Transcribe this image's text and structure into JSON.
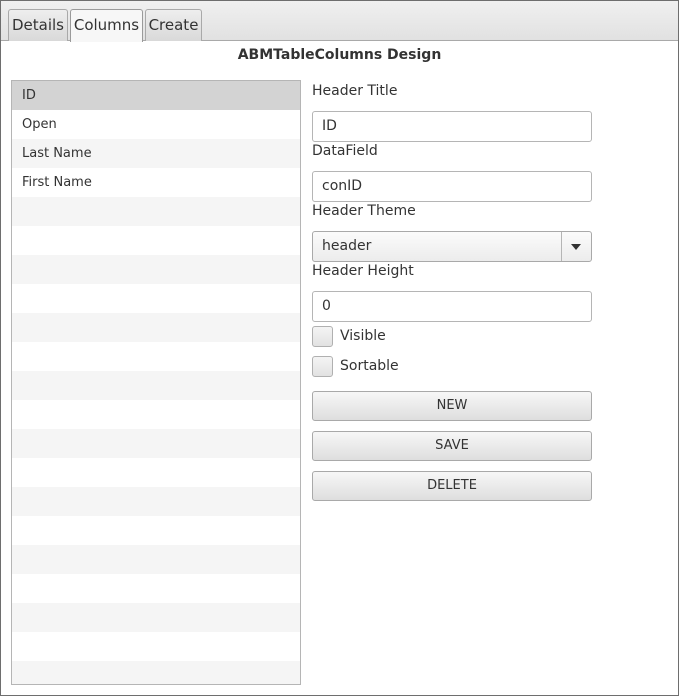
{
  "tabs": [
    {
      "label": "Details",
      "active": false
    },
    {
      "label": "Columns",
      "active": true
    },
    {
      "label": "Create",
      "active": false
    }
  ],
  "heading": "ABMTableColumns Design",
  "columns_list": {
    "items": [
      "ID",
      "Open",
      "Last Name",
      "First Name"
    ],
    "selected_index": 0
  },
  "form": {
    "header_title_label": "Header Title",
    "header_title_value": "ID",
    "datafield_label": "DataField",
    "datafield_value": "conID",
    "header_theme_label": "Header Theme",
    "header_theme_value": "header",
    "header_height_label": "Header Height",
    "header_height_value": "0",
    "visible_label": "Visible",
    "visible_checked": false,
    "sortable_label": "Sortable",
    "sortable_checked": false
  },
  "buttons": {
    "new": "NEW",
    "save": "SAVE",
    "delete": "DELETE"
  },
  "icons": {
    "combo_arrow": "chevron-down-icon"
  }
}
